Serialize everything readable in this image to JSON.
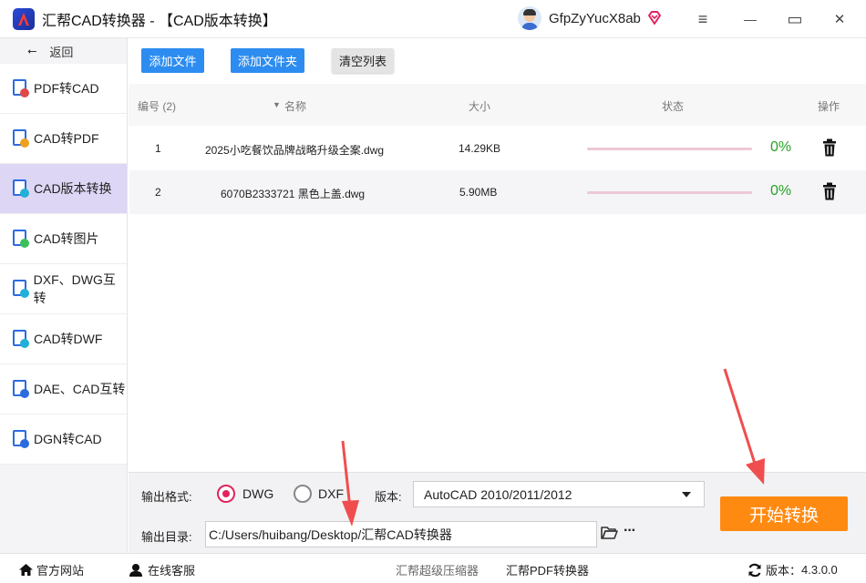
{
  "window": {
    "title": "汇帮CAD转换器 - 【CAD版本转换】",
    "username": "GfpZyYucX8ab",
    "controls": {
      "menu": "≡",
      "minimize": "—",
      "maximize": "▭",
      "close": "✕"
    }
  },
  "sidebar": {
    "back_label": "返回",
    "items": [
      {
        "label": "PDF转CAD",
        "badge_color": "#e04848"
      },
      {
        "label": "CAD转PDF",
        "badge_color": "#f0a020"
      },
      {
        "label": "CAD版本转换",
        "badge_color": "#22b0d8",
        "active": true
      },
      {
        "label": "CAD转图片",
        "badge_color": "#3cc05a"
      },
      {
        "label": "DXF、DWG互转",
        "badge_color": "#22b0d8"
      },
      {
        "label": "CAD转DWF",
        "badge_color": "#22b0d8"
      },
      {
        "label": "DAE、CAD互转",
        "badge_color": "#2b6be0"
      },
      {
        "label": "DGN转CAD",
        "badge_color": "#2b6be0"
      }
    ]
  },
  "toolbar": {
    "add_file": "添加文件",
    "add_folder": "添加文件夹",
    "clear_list": "清空列表"
  },
  "table": {
    "headers": {
      "index": "编号 (2)",
      "name": "名称",
      "size": "大小",
      "status": "状态",
      "action": "操作"
    },
    "rows": [
      {
        "index": "1",
        "name": "2025小吃餐饮品牌战略升级全案.dwg",
        "size": "14.29KB",
        "progress": "0%"
      },
      {
        "index": "2",
        "name": "6070B2333721 黑色上盖.dwg",
        "size": "5.90MB",
        "progress": "0%"
      }
    ]
  },
  "settings": {
    "format_label": "输出格式:",
    "format_options": [
      "DWG",
      "DXF"
    ],
    "format_selected": "DWG",
    "version_label": "版本:",
    "version_value": "AutoCAD 2010/2011/2012",
    "output_label": "输出目录:",
    "output_path": "C:/Users/huibang/Desktop/汇帮CAD转换器",
    "more_label": "···",
    "start_button": "开始转换"
  },
  "statusbar": {
    "website": "官方网站",
    "support": "在线客服",
    "link1": "汇帮超级压缩器",
    "link2": "汇帮PDF转换器",
    "version_label": "版本：",
    "version_value": "4.3.0.0"
  },
  "colors": {
    "accent_blue": "#2d8cf0",
    "start_orange": "#ff8a12",
    "active_nav": "#ddd6f5",
    "progress_green": "#26a326",
    "radio_red": "#e0245e"
  }
}
